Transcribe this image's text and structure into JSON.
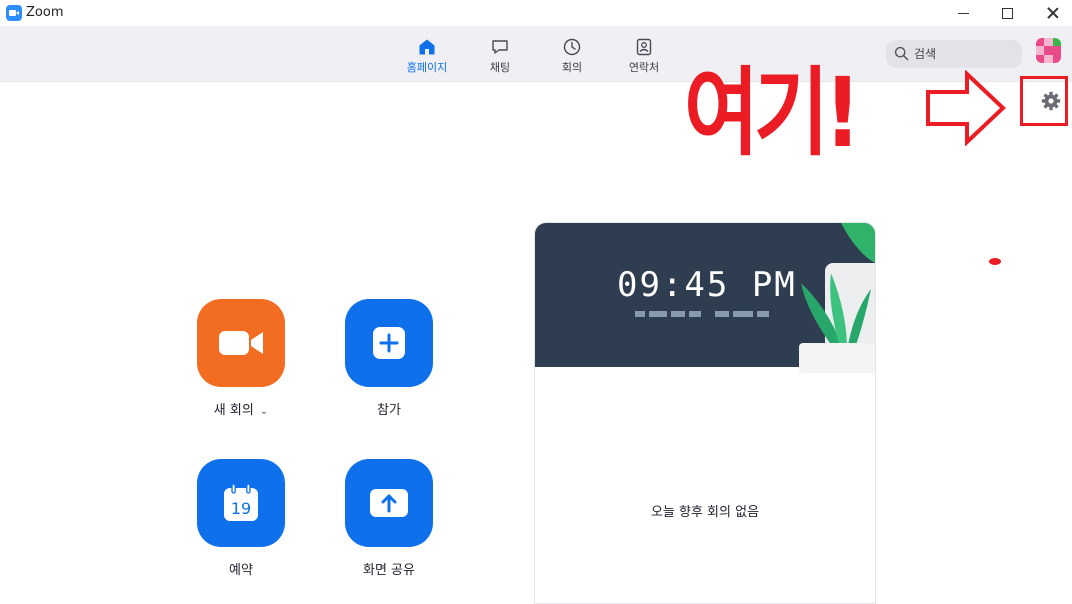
{
  "window": {
    "title": "Zoom"
  },
  "nav": {
    "tabs": [
      {
        "label": "홈페이지",
        "icon": "home-icon",
        "active": true
      },
      {
        "label": "채팅",
        "icon": "chat-icon",
        "active": false
      },
      {
        "label": "회의",
        "icon": "clock-icon",
        "active": false
      },
      {
        "label": "연락처",
        "icon": "contacts-icon",
        "active": false
      }
    ]
  },
  "search": {
    "placeholder": "검색"
  },
  "annotation": {
    "text": "여기!",
    "color": "#ec1c24"
  },
  "actions": {
    "new_meeting": "새 회의",
    "join": "참가",
    "schedule": "예약",
    "schedule_day": "19",
    "share_screen": "화면 공유"
  },
  "card": {
    "time": "09:45 PM",
    "empty_text": "오늘 향후 회의 없음"
  },
  "colors": {
    "accent": "#0e71eb",
    "new_meeting": "#f26d21",
    "hero_bg": "#2e3d50"
  }
}
